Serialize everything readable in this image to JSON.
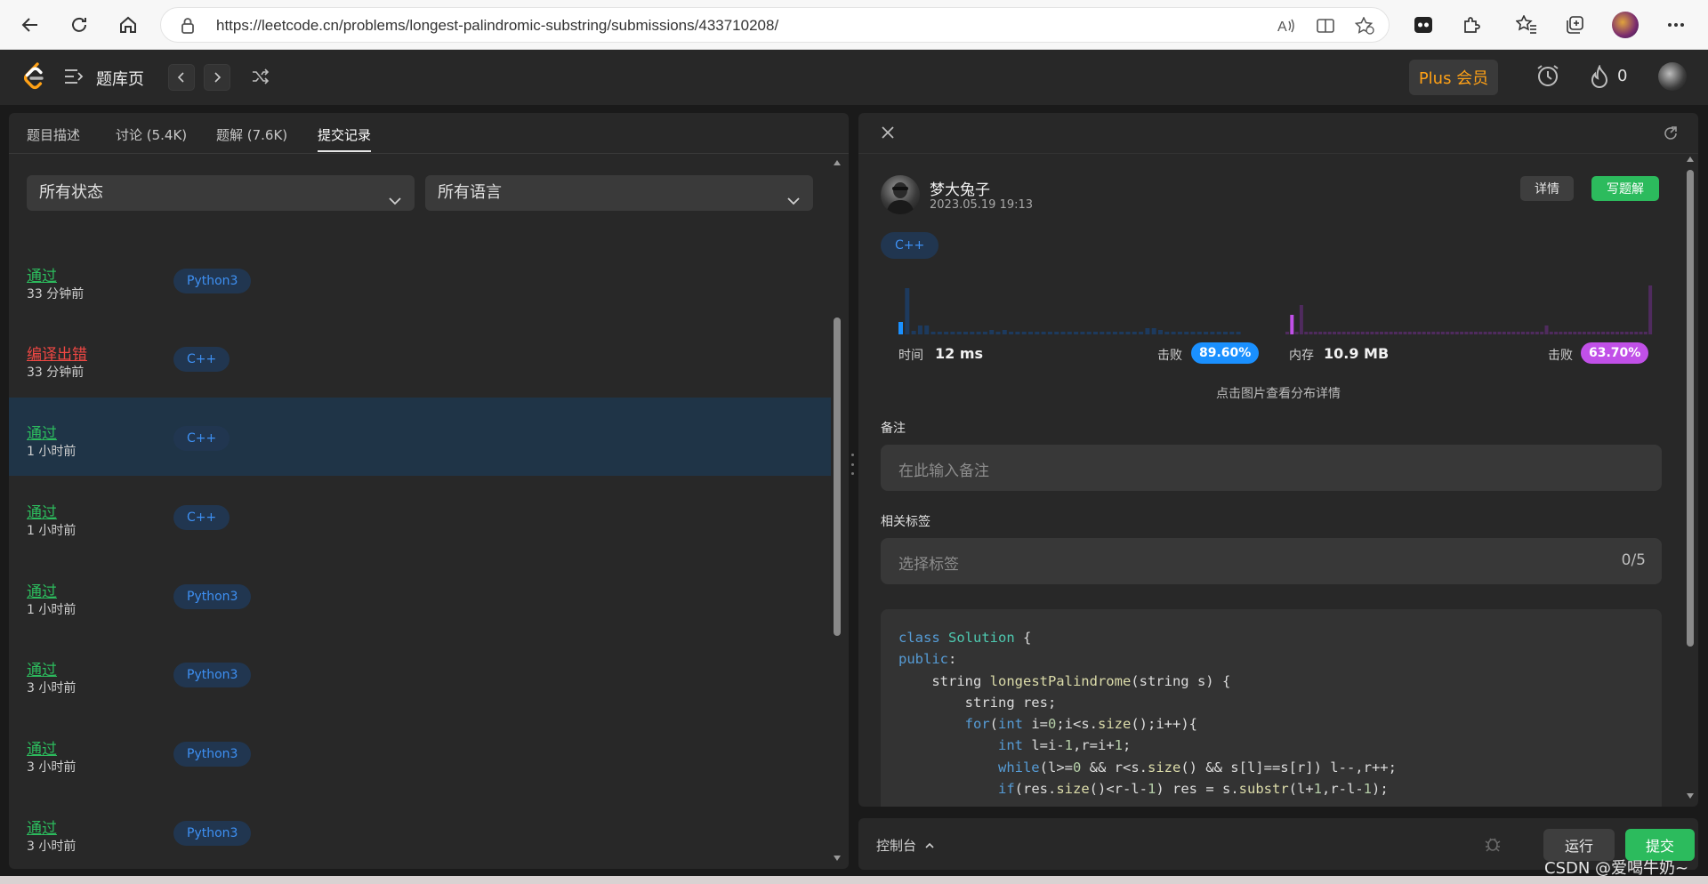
{
  "browser": {
    "url": "https://leetcode.cn/problems/longest-palindromic-substring/submissions/433710208/"
  },
  "header": {
    "title": "题库页",
    "plus_label": "Plus 会员",
    "streak_count": "0"
  },
  "tabs": [
    {
      "label": "题目描述"
    },
    {
      "label": "讨论 (5.4K)"
    },
    {
      "label": "题解 (7.6K)"
    },
    {
      "label": "提交记录"
    }
  ],
  "filters": {
    "status": "所有状态",
    "language": "所有语言"
  },
  "submissions": [
    {
      "status": "通过",
      "time": "33 分钟前",
      "lang": "Python3"
    },
    {
      "status": "编译出错",
      "time": "33 分钟前",
      "lang": "C++"
    },
    {
      "status": "通过",
      "time": "1 小时前",
      "lang": "C++"
    },
    {
      "status": "通过",
      "time": "1 小时前",
      "lang": "C++"
    },
    {
      "status": "通过",
      "time": "1 小时前",
      "lang": "Python3"
    },
    {
      "status": "通过",
      "time": "3 小时前",
      "lang": "Python3"
    },
    {
      "status": "通过",
      "time": "3 小时前",
      "lang": "Python3"
    },
    {
      "status": "通过",
      "time": "3 小时前",
      "lang": "Python3"
    }
  ],
  "detail": {
    "username": "梦大兔子",
    "date": "2023.05.19 19:13",
    "detail_btn": "详情",
    "write_btn": "写题解",
    "lang": "C++",
    "runtime_label": "时间",
    "runtime_value": "12 ms",
    "beat_label": "击败",
    "runtime_pct": "89.60%",
    "memory_label": "内存",
    "memory_value": "10.9 MB",
    "memory_pct": "63.70%",
    "hint": "点击图片查看分布详情",
    "note_label": "备注",
    "note_placeholder": "在此输入备注",
    "tags_label": "相关标签",
    "tags_placeholder": "选择标签",
    "tags_count": "0/5",
    "colors": {
      "accept": "#2cbb5d",
      "error": "#ef4743",
      "runtime": "#1a90ff",
      "memory": "#c150e8"
    }
  },
  "console": {
    "label": "控制台",
    "run": "运行",
    "submit": "提交"
  },
  "watermark": "CSDN @爱喝牛奶~"
}
